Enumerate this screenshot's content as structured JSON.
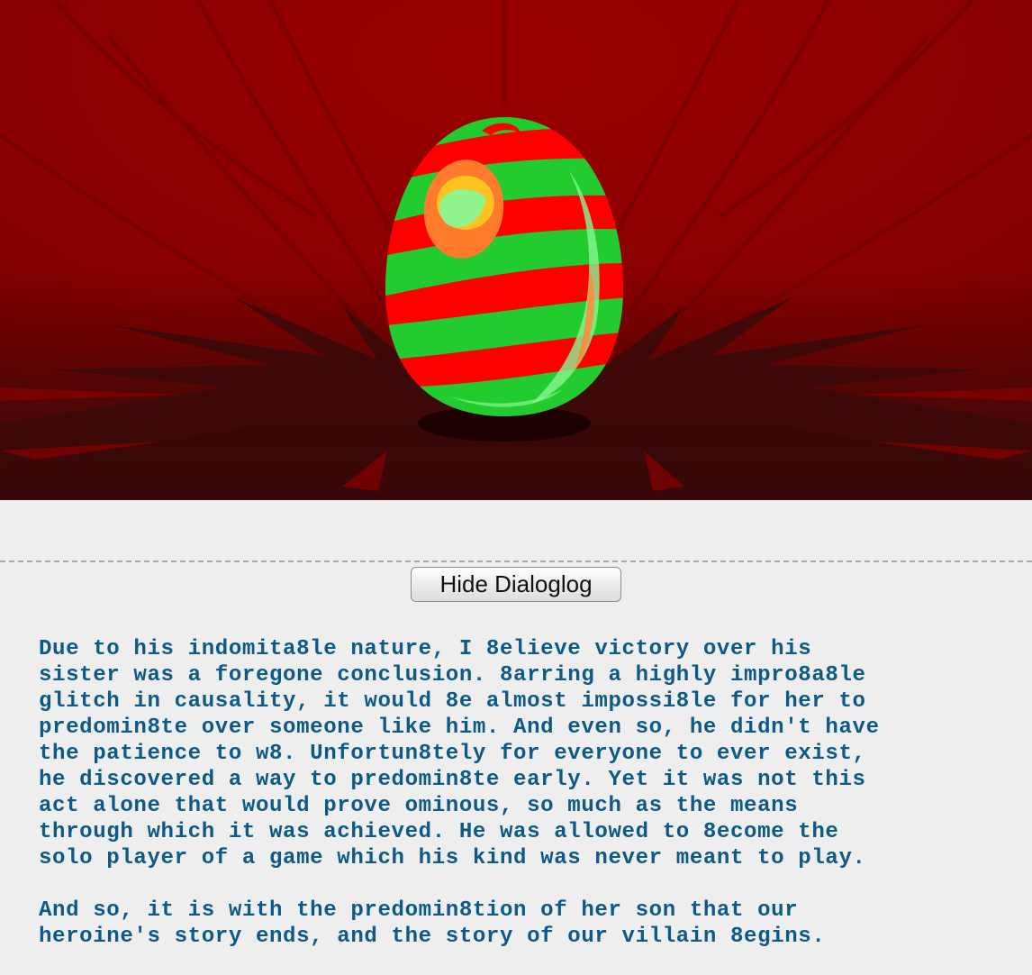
{
  "scene": {
    "colors": {
      "background": "#8e0000",
      "shadow": "#3d0b0b",
      "egg_red": "#ff0000",
      "egg_green": "#22cc2e",
      "highlight_orange": "#ff7a2a",
      "highlight_yellow": "#ffc21e",
      "highlight_green": "#8af594"
    },
    "object": "striped-egg"
  },
  "dialog_toggle": {
    "label": "Hide Dialoglog"
  },
  "dialog": {
    "color": "#0e5a87",
    "paragraph_1": "Due to his indomita8le nature, I 8elieve victory over his\nsister was a foregone conclusion. 8arring a highly impro8a8le\nglitch in causality, it would 8e almost impossi8le for her to\npredomin8te over someone like him. And even so, he didn't have\nthe patience to w8. Unfortun8tely for everyone to ever exist,\nhe discovered a way to predomin8te early. Yet it was not this\nact alone that would prove ominous, so much as the means\nthrough which it was achieved. He was allowed to 8ecome the\nsolo player of a game which his kind was never meant to play.",
    "paragraph_2": "And so, it is with the predomin8tion of her son that our\nheroine's story ends, and the story of our villain 8egins."
  }
}
